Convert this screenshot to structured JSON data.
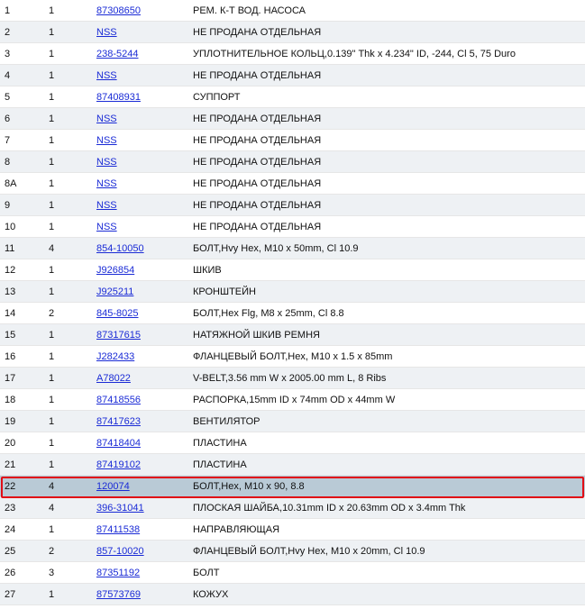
{
  "parts": {
    "rows": [
      {
        "pos": "1",
        "qty": "1",
        "part": "87308650",
        "desc": "РЕМ. К-Т ВОД. НАСОСА"
      },
      {
        "pos": "2",
        "qty": "1",
        "part": "NSS",
        "desc": "НЕ ПРОДАНА ОТДЕЛЬНАЯ"
      },
      {
        "pos": "3",
        "qty": "1",
        "part": "238-5244",
        "desc": "УПЛОТНИТЕЛЬНОЕ КОЛЬЦ,0.139\" Thk x 4.234\" ID, -244, Cl 5, 75 Duro"
      },
      {
        "pos": "4",
        "qty": "1",
        "part": "NSS",
        "desc": "НЕ ПРОДАНА ОТДЕЛЬНАЯ"
      },
      {
        "pos": "5",
        "qty": "1",
        "part": "87408931",
        "desc": "СУППОРТ"
      },
      {
        "pos": "6",
        "qty": "1",
        "part": "NSS",
        "desc": "НЕ ПРОДАНА ОТДЕЛЬНАЯ"
      },
      {
        "pos": "7",
        "qty": "1",
        "part": "NSS",
        "desc": "НЕ ПРОДАНА ОТДЕЛЬНАЯ"
      },
      {
        "pos": "8",
        "qty": "1",
        "part": "NSS",
        "desc": "НЕ ПРОДАНА ОТДЕЛЬНАЯ"
      },
      {
        "pos": "8A",
        "qty": "1",
        "part": "NSS",
        "desc": "НЕ ПРОДАНА ОТДЕЛЬНАЯ"
      },
      {
        "pos": "9",
        "qty": "1",
        "part": "NSS",
        "desc": "НЕ ПРОДАНА ОТДЕЛЬНАЯ"
      },
      {
        "pos": "10",
        "qty": "1",
        "part": "NSS",
        "desc": "НЕ ПРОДАНА ОТДЕЛЬНАЯ"
      },
      {
        "pos": "11",
        "qty": "4",
        "part": "854-10050",
        "desc": "БОЛТ,Hvy Hex, M10 x 50mm, Cl 10.9"
      },
      {
        "pos": "12",
        "qty": "1",
        "part": "J926854",
        "desc": "ШКИВ"
      },
      {
        "pos": "13",
        "qty": "1",
        "part": "J925211",
        "desc": "КРОНШТЕЙН"
      },
      {
        "pos": "14",
        "qty": "2",
        "part": "845-8025",
        "desc": "БОЛТ,Hex Flg, M8 x 25mm, Cl 8.8"
      },
      {
        "pos": "15",
        "qty": "1",
        "part": "87317615",
        "desc": "НАТЯЖНОЙ ШКИВ РЕМНЯ"
      },
      {
        "pos": "16",
        "qty": "1",
        "part": "J282433",
        "desc": "ФЛАНЦЕВЫЙ БОЛТ,Hex, M10 x 1.5 x 85mm"
      },
      {
        "pos": "17",
        "qty": "1",
        "part": "A78022",
        "desc": "V-BELT,3.56 mm W x 2005.00 mm L, 8 Ribs"
      },
      {
        "pos": "18",
        "qty": "1",
        "part": "87418556",
        "desc": "РАСПОРКА,15mm ID x 74mm OD x 44mm W"
      },
      {
        "pos": "19",
        "qty": "1",
        "part": "87417623",
        "desc": "ВЕНТИЛЯТОР"
      },
      {
        "pos": "20",
        "qty": "1",
        "part": "87418404",
        "desc": "ПЛАСТИНА"
      },
      {
        "pos": "21",
        "qty": "1",
        "part": "87419102",
        "desc": "ПЛАСТИНА"
      },
      {
        "pos": "22",
        "qty": "4",
        "part": "120074",
        "desc": "БОЛТ,Hex, M10 x 90, 8.8",
        "selected": true
      },
      {
        "pos": "23",
        "qty": "4",
        "part": "396-31041",
        "desc": "ПЛОСКАЯ ШАЙБА,10.31mm ID x 20.63mm OD x 3.4mm Thk"
      },
      {
        "pos": "24",
        "qty": "1",
        "part": "87411538",
        "desc": "НАПРАВЛЯЮЩАЯ"
      },
      {
        "pos": "25",
        "qty": "2",
        "part": "857-10020",
        "desc": "ФЛАНЦЕВЫЙ БОЛТ,Hvy Hex, M10 x 20mm, Cl 10.9"
      },
      {
        "pos": "26",
        "qty": "3",
        "part": "87351192",
        "desc": "БОЛТ"
      },
      {
        "pos": "27",
        "qty": "1",
        "part": "87573769",
        "desc": "КОЖУХ"
      }
    ]
  },
  "colors": {
    "link": "#1a2bd6",
    "row_alt": "#eef1f4",
    "row_selected": "#b9cad6",
    "highlight_border": "#e10d16"
  }
}
